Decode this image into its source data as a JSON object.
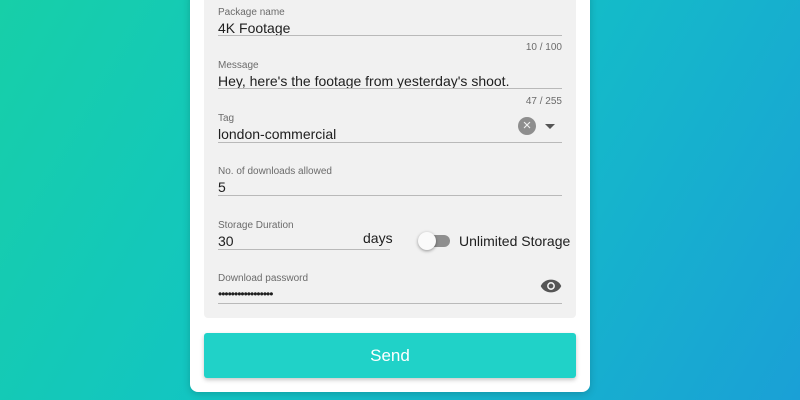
{
  "form": {
    "package_name": {
      "label": "Package name",
      "value": "4K Footage",
      "counter": "10 / 100"
    },
    "message": {
      "label": "Message",
      "value": "Hey, here's the footage from yesterday's shoot.",
      "counter": "47 / 255"
    },
    "tag": {
      "label": "Tag",
      "value": "london-commercial"
    },
    "downloads": {
      "label": "No. of downloads allowed",
      "value": "5"
    },
    "storage": {
      "label": "Storage Duration",
      "value": "30",
      "unit": "days",
      "toggle_label": "Unlimited Storage",
      "toggle_on": false
    },
    "password": {
      "label": "Download password",
      "masked_value": "•••••••••••••••••"
    }
  },
  "actions": {
    "send_label": "Send"
  },
  "colors": {
    "send_button": "#20d2c8",
    "toggle_off": "#8f8f8f",
    "panel": "#f1f1f1"
  }
}
